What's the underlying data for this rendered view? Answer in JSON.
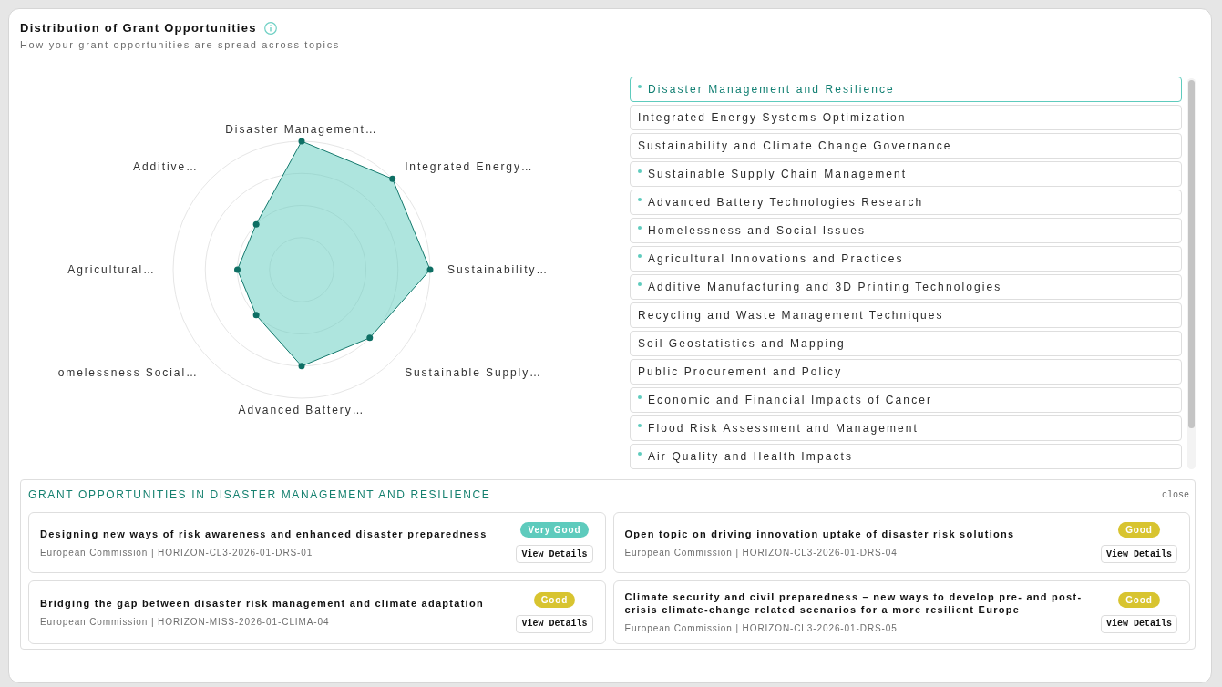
{
  "header": {
    "title": "Distribution of Grant Opportunities",
    "subtitle": "How your grant opportunities are spread across topics"
  },
  "radar_chart": {
    "axis_labels": [
      "Disaster Management…",
      "Additive…",
      "Integrated Energy…",
      "Agricultural…",
      "Sustainability…",
      "omelessness Social…",
      "Sustainable Supply…",
      "Advanced Battery…"
    ]
  },
  "topics": [
    {
      "label": "Disaster Management and Resilience",
      "dot": true,
      "selected": true
    },
    {
      "label": "Integrated Energy Systems Optimization",
      "dot": false,
      "selected": false
    },
    {
      "label": "Sustainability and Climate Change Governance",
      "dot": false,
      "selected": false
    },
    {
      "label": "Sustainable Supply Chain Management",
      "dot": true,
      "selected": false
    },
    {
      "label": "Advanced Battery Technologies Research",
      "dot": true,
      "selected": false
    },
    {
      "label": "Homelessness and Social Issues",
      "dot": true,
      "selected": false
    },
    {
      "label": "Agricultural Innovations and Practices",
      "dot": true,
      "selected": false
    },
    {
      "label": "Additive Manufacturing and 3D Printing Technologies",
      "dot": true,
      "selected": false
    },
    {
      "label": "Recycling and Waste Management Techniques",
      "dot": false,
      "selected": false
    },
    {
      "label": "Soil Geostatistics and Mapping",
      "dot": false,
      "selected": false
    },
    {
      "label": "Public Procurement and Policy",
      "dot": false,
      "selected": false
    },
    {
      "label": "Economic and Financial Impacts of Cancer",
      "dot": true,
      "selected": false
    },
    {
      "label": "Flood Risk Assessment and Management",
      "dot": true,
      "selected": false
    },
    {
      "label": "Air Quality and Health Impacts",
      "dot": true,
      "selected": false
    }
  ],
  "opportunities_panel": {
    "title": "GRANT OPPORTUNITIES IN DISASTER MANAGEMENT AND RESILIENCE",
    "close_label": "close",
    "cards": [
      {
        "title": "Designing new ways of risk awareness and enhanced disaster preparedness",
        "meta": "European Commission | HORIZON-CL3-2026-01-DRS-01",
        "badge": {
          "label": "Very Good",
          "color": "#5ecbbd"
        },
        "button": "View Details"
      },
      {
        "title": "Open topic on driving innovation uptake of disaster risk solutions",
        "meta": "European Commission | HORIZON-CL3-2026-01-DRS-04",
        "badge": {
          "label": "Good",
          "color": "#d8c430"
        },
        "button": "View Details"
      },
      {
        "title": "Bridging the gap between disaster risk management and climate adaptation",
        "meta": "European Commission | HORIZON-MISS-2026-01-CLIMA-04",
        "badge": {
          "label": "Good",
          "color": "#d8c430"
        },
        "button": "View Details"
      },
      {
        "title": "Climate security and civil preparedness – new ways to develop pre- and post-crisis climate-change related scenarios for a more resilient Europe",
        "meta": "European Commission | HORIZON-CL3-2026-01-DRS-05",
        "badge": {
          "label": "Good",
          "color": "#d8c430"
        },
        "button": "View Details"
      }
    ]
  }
}
